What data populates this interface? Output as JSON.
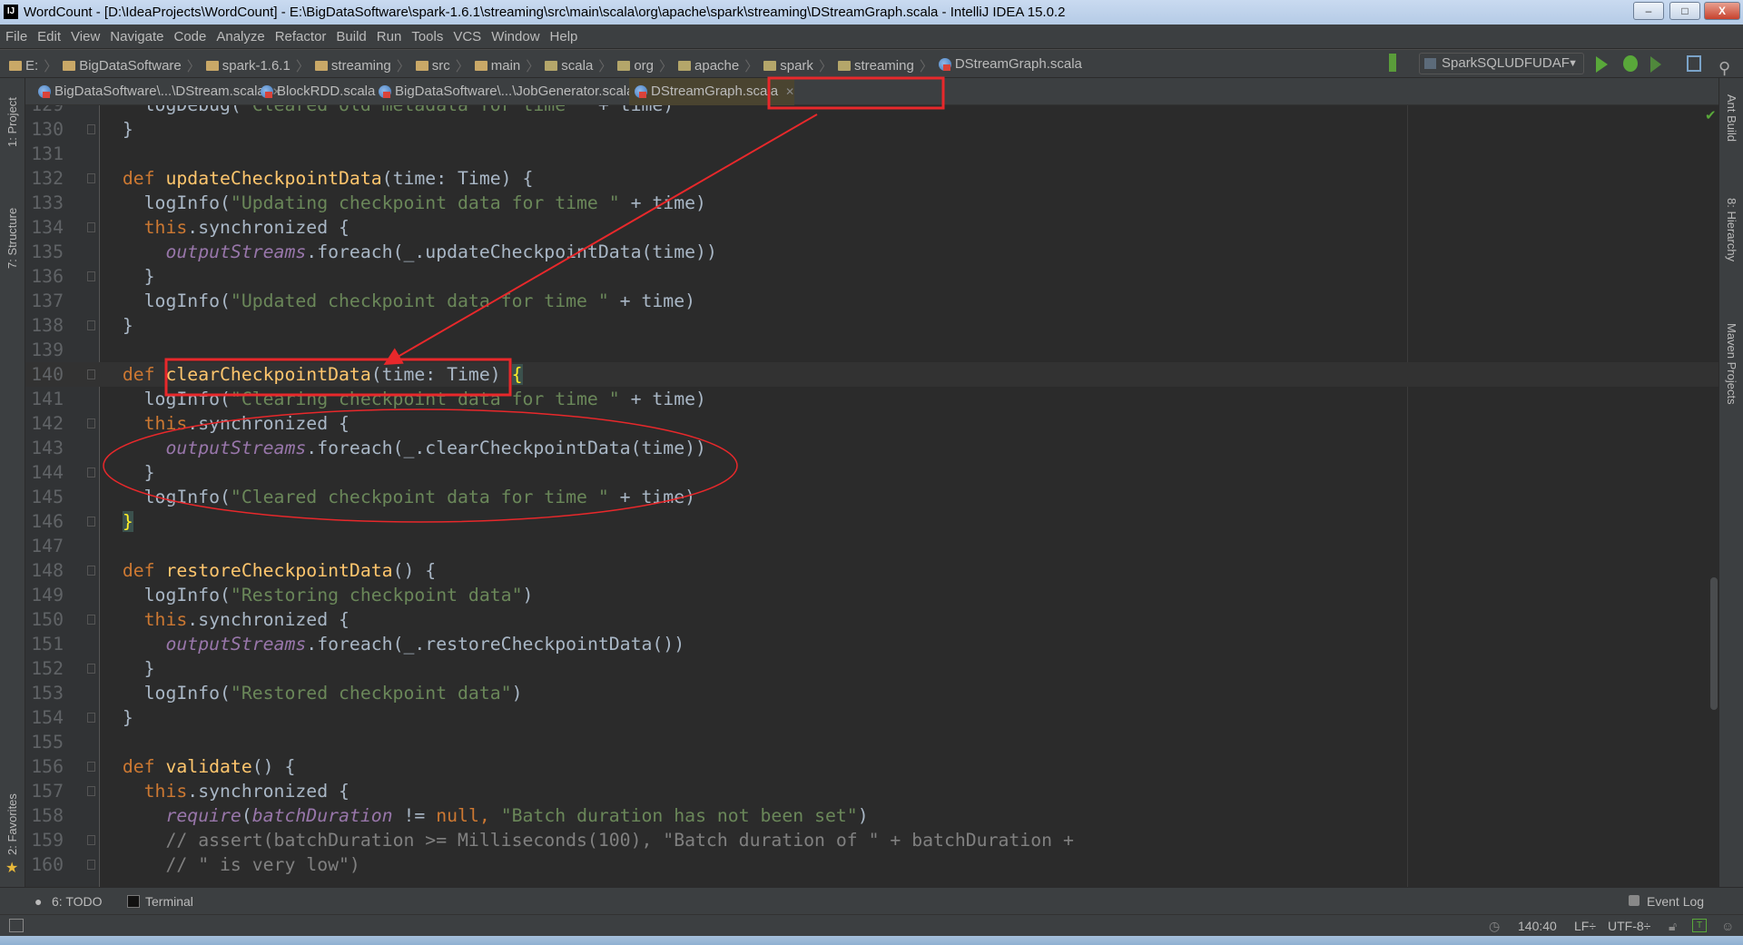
{
  "window": {
    "title": "WordCount - [D:\\IdeaProjects\\WordCount] - E:\\BigDataSoftware\\spark-1.6.1\\streaming\\src\\main\\scala\\org\\apache\\spark\\streaming\\DStreamGraph.scala - IntelliJ IDEA 15.0.2",
    "logo": "IJ",
    "minimize": "–",
    "maximize": "□",
    "close": "X"
  },
  "menu": [
    "File",
    "Edit",
    "View",
    "Navigate",
    "Code",
    "Analyze",
    "Refactor",
    "Build",
    "Run",
    "Tools",
    "VCS",
    "Window",
    "Help"
  ],
  "breadcrumbs": [
    {
      "label": "E:",
      "icon": "folder-icon"
    },
    {
      "label": "BigDataSoftware",
      "icon": "folder-icon"
    },
    {
      "label": "spark-1.6.1",
      "icon": "folder-icon"
    },
    {
      "label": "streaming",
      "icon": "folder-icon"
    },
    {
      "label": "src",
      "icon": "folder-icon"
    },
    {
      "label": "main",
      "icon": "folder-icon"
    },
    {
      "label": "scala",
      "icon": "package-icon"
    },
    {
      "label": "org",
      "icon": "package-icon"
    },
    {
      "label": "apache",
      "icon": "package-icon"
    },
    {
      "label": "spark",
      "icon": "package-icon"
    },
    {
      "label": "streaming",
      "icon": "package-icon"
    },
    {
      "label": "DStreamGraph.scala",
      "icon": "scala-file-icon"
    }
  ],
  "run_config": "SparkSQLUDFUDAF",
  "tabs": [
    {
      "label": "BigDataSoftware\\...\\DStream.scala",
      "active": false
    },
    {
      "label": "BlockRDD.scala",
      "active": false
    },
    {
      "label": "BigDataSoftware\\...\\JobGenerator.scala",
      "active": false
    },
    {
      "label": "DStreamGraph.scala",
      "active": true
    }
  ],
  "left_tools": [
    "1: Project",
    "7: Structure",
    "2: Favorites"
  ],
  "right_tools": [
    "Ant Build",
    "8: Hierarchy",
    "Maven Projects"
  ],
  "colors": {
    "keyword": "#cc7832",
    "string": "#6a8759",
    "field": "#9876aa",
    "function": "#ffc66d",
    "text": "#a9b7c6",
    "comment": "#808080",
    "annotation": "#e8282b"
  },
  "editor": {
    "current_line": 140,
    "lines": [
      {
        "n": "129",
        "t": [
          [
            "",
            "    logDebug("
          ],
          [
            "str",
            "\"Cleared old metadata for time \""
          ],
          [
            "",
            " + time)"
          ]
        ]
      },
      {
        "n": "130",
        "t": [
          [
            "",
            "  }"
          ]
        ],
        "fold": true
      },
      {
        "n": "131",
        "t": []
      },
      {
        "n": "132",
        "t": [
          [
            "",
            "  "
          ],
          [
            "kw",
            "def "
          ],
          [
            "fn",
            "updateCheckpointData"
          ],
          [
            "",
            "(time: Time) {"
          ]
        ],
        "fold": true
      },
      {
        "n": "133",
        "t": [
          [
            "",
            "    logInfo("
          ],
          [
            "str",
            "\"Updating checkpoint data for time \""
          ],
          [
            "",
            " + time)"
          ]
        ]
      },
      {
        "n": "134",
        "t": [
          [
            "",
            "    "
          ],
          [
            "kw",
            "this"
          ],
          [
            "",
            ".synchronized {"
          ]
        ],
        "fold": true
      },
      {
        "n": "135",
        "t": [
          [
            "",
            "      "
          ],
          [
            "fld",
            "outputStreams"
          ],
          [
            "",
            ".foreach(_.updateCheckpointData(time))"
          ]
        ]
      },
      {
        "n": "136",
        "t": [
          [
            "",
            "    }"
          ]
        ],
        "fold": true
      },
      {
        "n": "137",
        "t": [
          [
            "",
            "    logInfo("
          ],
          [
            "str",
            "\"Updated checkpoint data for time \""
          ],
          [
            "",
            " + time)"
          ]
        ]
      },
      {
        "n": "138",
        "t": [
          [
            "",
            "  }"
          ]
        ],
        "fold": true
      },
      {
        "n": "139",
        "t": []
      },
      {
        "n": "140",
        "t": [
          [
            "",
            "  "
          ],
          [
            "kw",
            "def "
          ],
          [
            "fn",
            "clearCheckpointData"
          ],
          [
            "",
            "(time: Time) "
          ],
          [
            "br",
            "{"
          ]
        ],
        "fold": true
      },
      {
        "n": "141",
        "t": [
          [
            "",
            "    logInfo("
          ],
          [
            "str",
            "\"Clearing checkpoint data for time \""
          ],
          [
            "",
            " + time)"
          ]
        ]
      },
      {
        "n": "142",
        "t": [
          [
            "",
            "    "
          ],
          [
            "kw",
            "this"
          ],
          [
            "",
            ".synchronized {"
          ]
        ],
        "fold": true
      },
      {
        "n": "143",
        "t": [
          [
            "",
            "      "
          ],
          [
            "fld",
            "outputStreams"
          ],
          [
            "",
            ".foreach(_.clearCheckpointData(time))"
          ]
        ]
      },
      {
        "n": "144",
        "t": [
          [
            "",
            "    }"
          ]
        ],
        "fold": true
      },
      {
        "n": "145",
        "t": [
          [
            "",
            "    logInfo("
          ],
          [
            "str",
            "\"Cleared checkpoint data for time \""
          ],
          [
            "",
            " + time)"
          ]
        ]
      },
      {
        "n": "146",
        "t": [
          [
            "",
            "  "
          ],
          [
            "br",
            "}"
          ]
        ],
        "fold": true
      },
      {
        "n": "147",
        "t": []
      },
      {
        "n": "148",
        "t": [
          [
            "",
            "  "
          ],
          [
            "kw",
            "def "
          ],
          [
            "fn",
            "restoreCheckpointData"
          ],
          [
            "",
            "() {"
          ]
        ],
        "fold": true
      },
      {
        "n": "149",
        "t": [
          [
            "",
            "    logInfo("
          ],
          [
            "str",
            "\"Restoring checkpoint data\""
          ],
          [
            "",
            ")"
          ]
        ]
      },
      {
        "n": "150",
        "t": [
          [
            "",
            "    "
          ],
          [
            "kw",
            "this"
          ],
          [
            "",
            ".synchronized {"
          ]
        ],
        "fold": true
      },
      {
        "n": "151",
        "t": [
          [
            "",
            "      "
          ],
          [
            "fld",
            "outputStreams"
          ],
          [
            "",
            ".foreach(_.restoreCheckpointData())"
          ]
        ]
      },
      {
        "n": "152",
        "t": [
          [
            "",
            "    }"
          ]
        ],
        "fold": true
      },
      {
        "n": "153",
        "t": [
          [
            "",
            "    logInfo("
          ],
          [
            "str",
            "\"Restored checkpoint data\""
          ],
          [
            "",
            ")"
          ]
        ]
      },
      {
        "n": "154",
        "t": [
          [
            "",
            "  }"
          ]
        ],
        "fold": true
      },
      {
        "n": "155",
        "t": []
      },
      {
        "n": "156",
        "t": [
          [
            "",
            "  "
          ],
          [
            "kw",
            "def "
          ],
          [
            "fn",
            "validate"
          ],
          [
            "",
            "() {"
          ]
        ],
        "fold": true
      },
      {
        "n": "157",
        "t": [
          [
            "",
            "    "
          ],
          [
            "kw",
            "this"
          ],
          [
            "",
            ".synchronized {"
          ]
        ],
        "fold": true
      },
      {
        "n": "158",
        "t": [
          [
            "",
            "      "
          ],
          [
            "fld",
            "require"
          ],
          [
            "",
            "("
          ],
          [
            "fld",
            "batchDuration"
          ],
          [
            "",
            " != "
          ],
          [
            "kw",
            "null, "
          ],
          [
            "str",
            "\"Batch duration has not been set\""
          ],
          [
            "",
            ")"
          ]
        ]
      },
      {
        "n": "159",
        "t": [
          [
            "",
            "      "
          ],
          [
            "cmt",
            "// assert(batchDuration >= Milliseconds(100), \"Batch duration of \" + batchDuration +"
          ]
        ],
        "fold": true
      },
      {
        "n": "160",
        "t": [
          [
            "",
            "      "
          ],
          [
            "cmt",
            "// \" is very low\")"
          ]
        ],
        "fold": true
      }
    ]
  },
  "bottom_tools": {
    "todo": "6: TODO",
    "terminal": "Terminal",
    "event_log": "Event Log"
  },
  "status": {
    "position": "140:40",
    "line_sep": "LF÷",
    "encoding": "UTF-8÷"
  }
}
